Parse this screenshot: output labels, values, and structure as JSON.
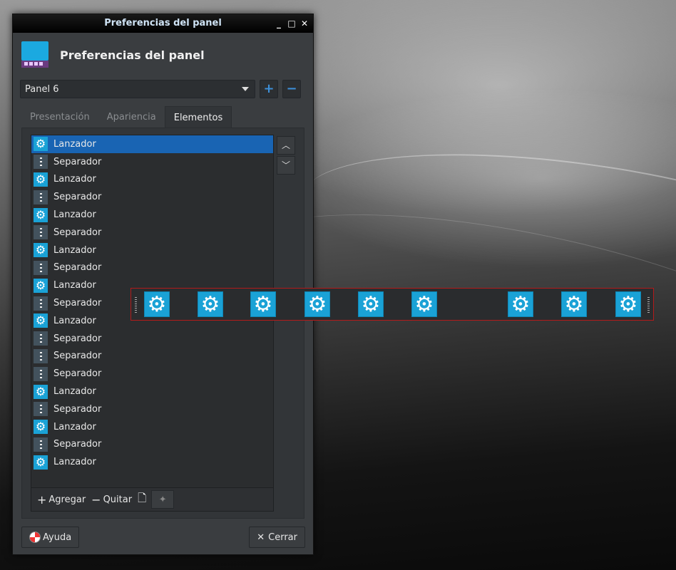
{
  "window": {
    "title": "Preferencias del panel",
    "controls": {
      "minimize": "_",
      "maximize": "□",
      "close": "✕"
    }
  },
  "header": {
    "title": "Preferencias del panel"
  },
  "panel_selector": {
    "value": "Panel 6",
    "add": "+",
    "remove": "−"
  },
  "tabs": [
    {
      "label": "Presentación",
      "active": false
    },
    {
      "label": "Apariencia",
      "active": false
    },
    {
      "label": "Elementos",
      "active": true
    }
  ],
  "items": [
    {
      "label": "Lanzador",
      "type": "launcher"
    },
    {
      "label": "Separador",
      "type": "separator"
    },
    {
      "label": "Lanzador",
      "type": "launcher"
    },
    {
      "label": "Separador",
      "type": "separator"
    },
    {
      "label": "Lanzador",
      "type": "launcher"
    },
    {
      "label": "Separador",
      "type": "separator"
    },
    {
      "label": "Lanzador",
      "type": "launcher"
    },
    {
      "label": "Separador",
      "type": "separator"
    },
    {
      "label": "Lanzador",
      "type": "launcher"
    },
    {
      "label": "Separador",
      "type": "separator"
    },
    {
      "label": "Lanzador",
      "type": "launcher"
    },
    {
      "label": "Separador",
      "type": "separator"
    },
    {
      "label": "Separador",
      "type": "separator"
    },
    {
      "label": "Separador",
      "type": "separator"
    },
    {
      "label": "Lanzador",
      "type": "launcher"
    },
    {
      "label": "Separador",
      "type": "separator"
    },
    {
      "label": "Lanzador",
      "type": "launcher"
    },
    {
      "label": "Separador",
      "type": "separator"
    },
    {
      "label": "Lanzador",
      "type": "launcher"
    }
  ],
  "selected_index": 0,
  "list_footer": {
    "add": "Agregar",
    "remove": "Quitar"
  },
  "buttons": {
    "help": "Ayuda",
    "close": "Cerrar"
  },
  "colors": {
    "accent": "#1964b3",
    "launcher_icon": "#1aa2d6",
    "dock_border": "#b31b1b"
  }
}
